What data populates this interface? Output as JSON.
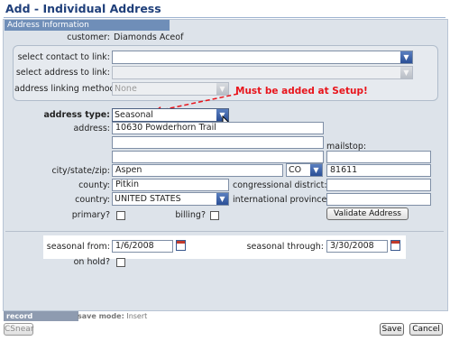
{
  "header": {
    "title": "Add - Individual Address"
  },
  "section": {
    "label": "Address Information"
  },
  "customer": {
    "label": "customer:",
    "value": "Diamonds Aceof"
  },
  "linking": {
    "contact_label": "select contact to link:",
    "address_label": "select address to link:",
    "method_label": "address linking method:",
    "method_value": "None"
  },
  "annotation": {
    "text": "Must be added at Setup!",
    "color": "#e8141b"
  },
  "address": {
    "type_label": "address type:",
    "type_value": "Seasonal",
    "address_label": "address:",
    "line1": "10630 Powderhorn Trail",
    "mailstop_label": "mailstop:",
    "csz_label": "city/state/zip:",
    "city": "Aspen",
    "state": "CO",
    "zip": "81611",
    "county_label": "county:",
    "county": "Pitkin",
    "congressional_label": "congressional district:",
    "country_label": "country:",
    "country": "UNITED STATES",
    "intl_province_label": "international province:",
    "primary_label": "primary?",
    "billing_label": "billing?",
    "validate_label": "Validate Address"
  },
  "seasonal": {
    "from_label": "seasonal from:",
    "from_value": "1/6/2008",
    "through_label": "seasonal through:",
    "through_value": "3/30/2008",
    "on_hold_label": "on hold?"
  },
  "footer": {
    "record_info": "record information",
    "save_mode_label": "save mode:",
    "save_mode_value": "Insert",
    "csnear_label": "CSnear",
    "save_label": "Save",
    "cancel_label": "Cancel"
  }
}
